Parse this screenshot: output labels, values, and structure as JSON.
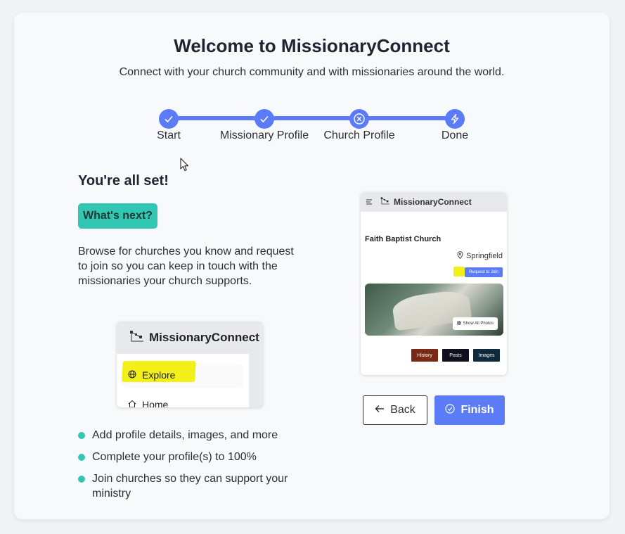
{
  "header": {
    "title": "Welcome to MissionaryConnect",
    "subtitle": "Connect with your church community and with missionaries around the world."
  },
  "stepper": {
    "steps": [
      {
        "label": "Start",
        "state": "completed",
        "icon": "check-icon"
      },
      {
        "label": "Missionary Profile",
        "state": "completed",
        "icon": "check-icon"
      },
      {
        "label": "Church Profile",
        "state": "skipped",
        "icon": "x-circle-icon"
      },
      {
        "label": "Done",
        "state": "current",
        "icon": "lightning-icon"
      }
    ]
  },
  "content": {
    "heading": "You're all set!",
    "badge": "What's next?",
    "paragraph": "Browse for churches you know and request to join so you can keep in touch with the missionaries your church supports.",
    "bullets": [
      "Add profile details, images, and more",
      "Complete your profile(s) to 100%",
      "Join churches so they can support your ministry"
    ]
  },
  "left_preview": {
    "brand": "MissionaryConnect",
    "explore_label": "Explore",
    "home_label": "Home"
  },
  "right_preview": {
    "brand": "MissionaryConnect",
    "church_name": "Faith Baptist Church",
    "location": "Springfield",
    "request_label": "Request to Join",
    "show_all_label": "Show All Photos",
    "tabs": [
      {
        "label": "History",
        "color": "#7a2a14"
      },
      {
        "label": "Posts",
        "color": "#0f0f1f"
      },
      {
        "label": "Images",
        "color": "#0f2a3a"
      }
    ]
  },
  "actions": {
    "back_label": "Back",
    "finish_label": "Finish"
  },
  "colors": {
    "accent": "#5b7cf6",
    "teal": "#33c6b2",
    "highlight": "#f2f018"
  }
}
